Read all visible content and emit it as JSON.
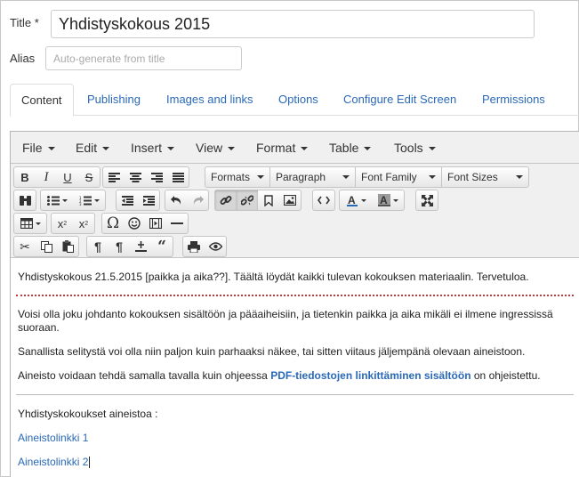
{
  "form": {
    "title_label": "Title *",
    "title_value": "Yhdistyskokous 2015",
    "alias_label": "Alias",
    "alias_placeholder": "Auto-generate from title"
  },
  "tabs": [
    {
      "label": "Content",
      "active": true
    },
    {
      "label": "Publishing"
    },
    {
      "label": "Images and links"
    },
    {
      "label": "Options"
    },
    {
      "label": "Configure Edit Screen"
    },
    {
      "label": "Permissions"
    }
  ],
  "menubar": [
    {
      "label": "File"
    },
    {
      "label": "Edit"
    },
    {
      "label": "Insert"
    },
    {
      "label": "View"
    },
    {
      "label": "Format"
    },
    {
      "label": "Table"
    },
    {
      "label": "Tools"
    }
  ],
  "toolbar": {
    "formats": "Formats",
    "paragraph": "Paragraph",
    "font_family": "Font Family",
    "font_sizes": "Font Sizes",
    "icons": {
      "row1": [
        "bold-icon",
        "italic-icon",
        "underline-icon",
        "strikethrough-icon",
        "align-left-icon",
        "align-center-icon",
        "align-right-icon",
        "align-justify-icon"
      ],
      "row2": [
        "find-icon",
        "bullet-list-icon",
        "numbered-list-icon",
        "outdent-icon",
        "indent-icon",
        "undo-icon",
        "redo-icon",
        "link-icon",
        "unlink-icon",
        "bookmark-icon",
        "image-icon",
        "code-icon",
        "text-color-icon",
        "background-color-icon",
        "fullscreen-icon"
      ],
      "row3": [
        "table-icon",
        "subscript-icon",
        "superscript-icon",
        "omega-icon",
        "emoticon-icon",
        "media-icon",
        "horizontal-rule-icon"
      ],
      "row4": [
        "cut-icon",
        "copy-icon",
        "paste-icon",
        "show-blocks-icon",
        "paragraph-mark-icon",
        "insert-date-icon",
        "blockquote-icon",
        "print-icon",
        "preview-icon"
      ]
    },
    "text_color": "#2a69b8",
    "bg_color": "#555555"
  },
  "content": {
    "intro": "Yhdistyskokous 21.5.2015 [paikka ja aika??]. Täältä löydät kaikki tulevan kokouksen materiaalin. Tervetuloa.",
    "para1": "Voisi olla joku johdanto kokouksen sisältöön ja pääaiheisiin, ja tietenkin paikka ja aika mikäli ei ilmene ingressissä suoraan.",
    "para2": "Sanallista selitystä voi olla niin paljon kuin parhaaksi näkee, tai sitten viitaus jäljempänä olevaan aineistoon.",
    "para3_before": "Aineisto voidaan tehdä samalla tavalla kuin ohjeessa ",
    "para3_link": "PDF-tiedostojen linkittäminen sisältöön",
    "para3_after": " on ohjeistettu.",
    "materials_heading": "Yhdistyskokoukset aineistoa :",
    "link1": "Aineistolinkki 1",
    "link2": "Aineistolinkki 2"
  },
  "colors": {
    "link": "#2a69b8",
    "pagebreak": "#c23a3a"
  }
}
